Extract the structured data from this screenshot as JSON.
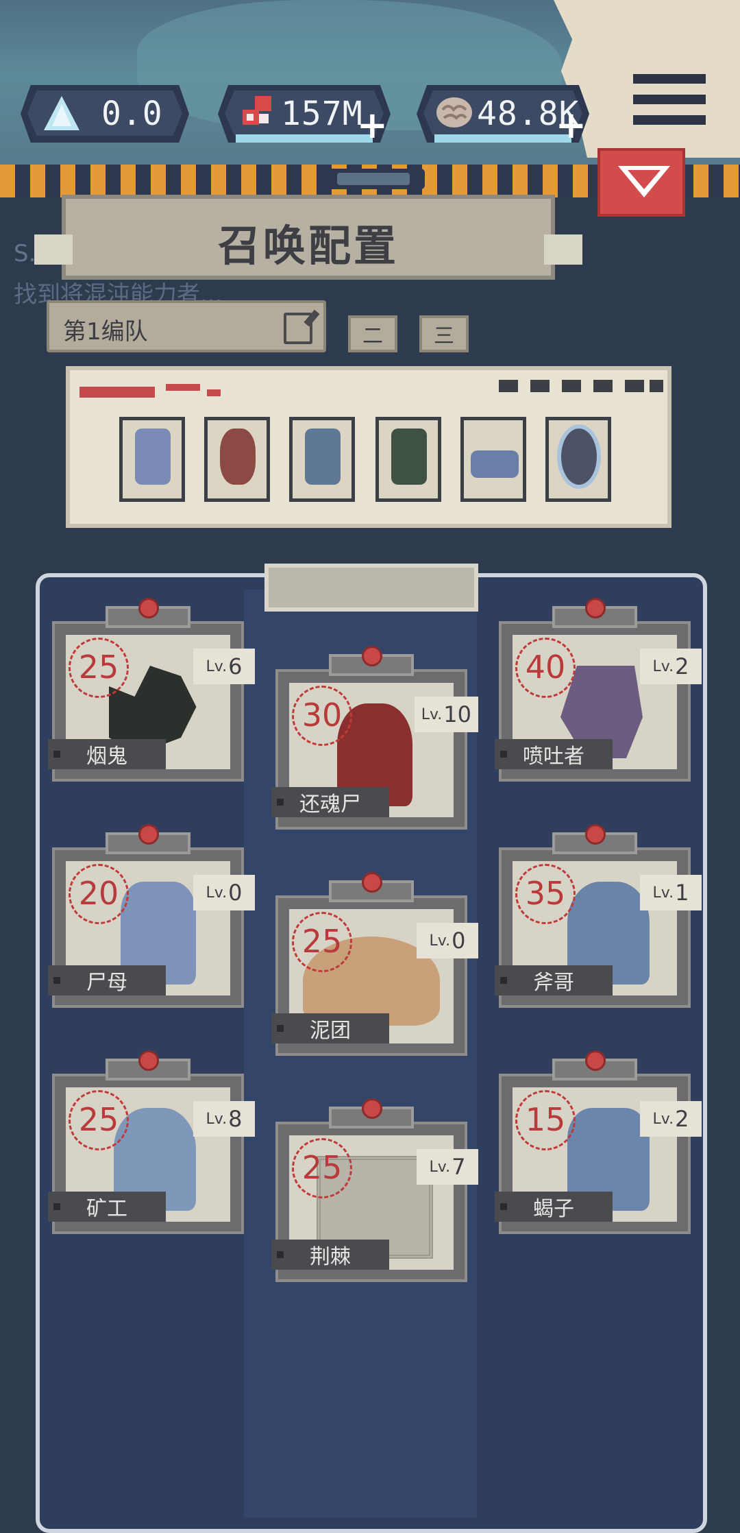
{
  "currencies": [
    {
      "id": "crystal",
      "icon": "crystal-icon",
      "value": "0.0",
      "has_plus": false
    },
    {
      "id": "blood",
      "icon": "blood-cells-icon",
      "value": "157M",
      "has_plus": true
    },
    {
      "id": "brain",
      "icon": "brain-icon",
      "value": "48.8K",
      "has_plus": true
    }
  ],
  "quest": {
    "code": "S.O",
    "text": "找到将混沌能力者..."
  },
  "title": "召唤配置",
  "team": {
    "label": "第1编队",
    "tabs": [
      "二",
      "三"
    ]
  },
  "roster_slots": 6,
  "units": [
    {
      "name": "烟鬼",
      "cost": "25",
      "level": "6",
      "lv_prefix": "Lv."
    },
    {
      "name": "还魂尸",
      "cost": "30",
      "level": "10",
      "lv_prefix": "Lv."
    },
    {
      "name": "喷吐者",
      "cost": "40",
      "level": "2",
      "lv_prefix": "Lv."
    },
    {
      "name": "尸母",
      "cost": "20",
      "level": "0",
      "lv_prefix": "Lv."
    },
    {
      "name": "泥团",
      "cost": "25",
      "level": "0",
      "lv_prefix": "Lv."
    },
    {
      "name": "斧哥",
      "cost": "35",
      "level": "1",
      "lv_prefix": "Lv."
    },
    {
      "name": "矿工",
      "cost": "25",
      "level": "8",
      "lv_prefix": "Lv."
    },
    {
      "name": "荆棘",
      "cost": "25",
      "level": "7",
      "lv_prefix": "Lv."
    },
    {
      "name": "蝎子",
      "cost": "15",
      "level": "2",
      "lv_prefix": "Lv."
    }
  ],
  "colors": {
    "accent_red": "#d24c4c",
    "board": "#2e3e5c",
    "cost_red": "#b83a3a"
  }
}
